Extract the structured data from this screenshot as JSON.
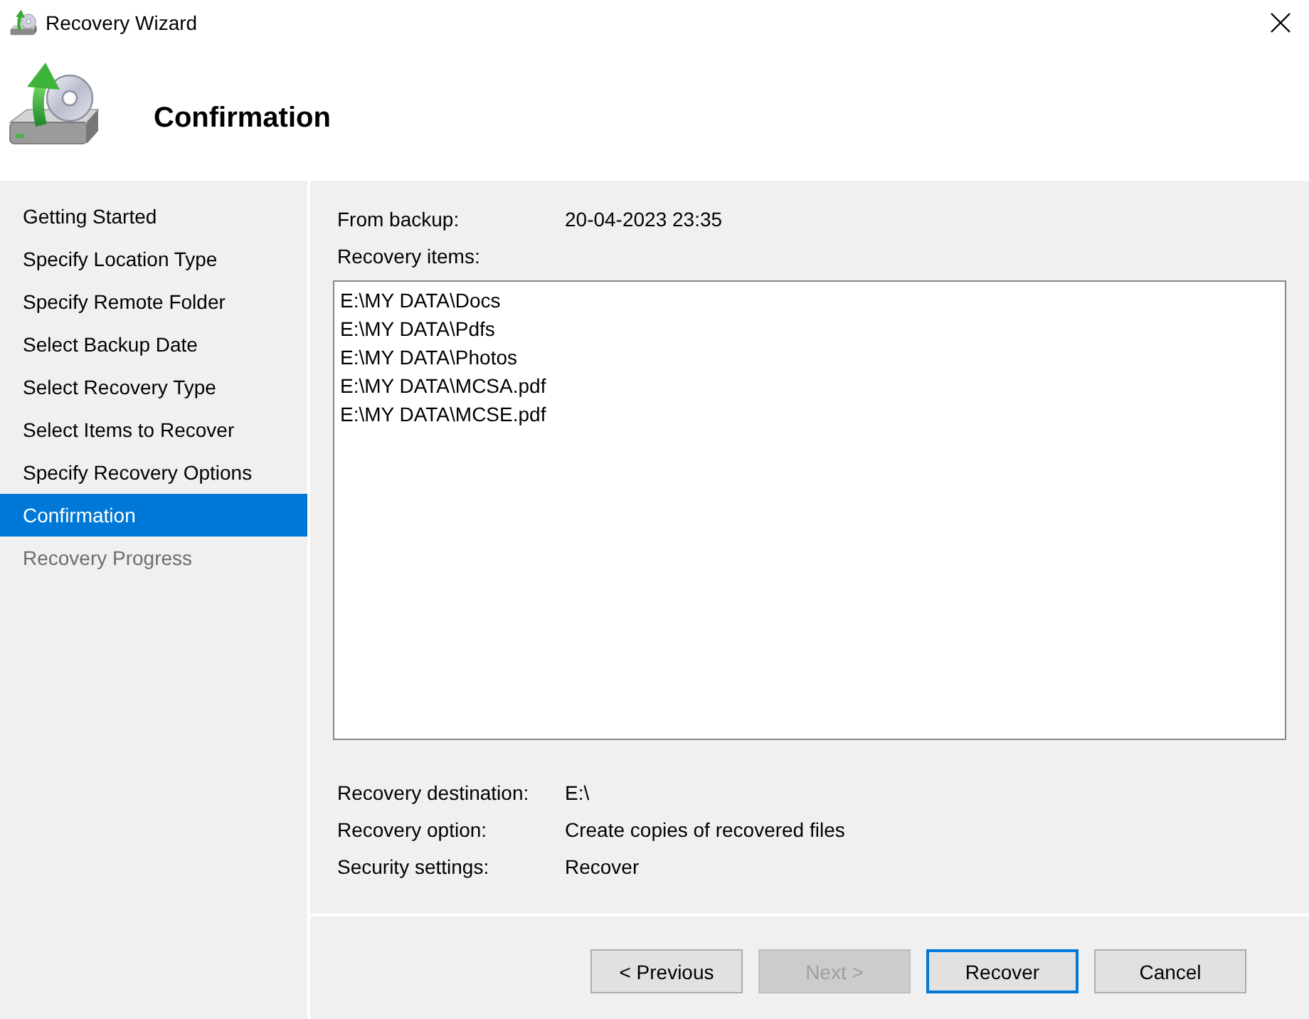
{
  "window": {
    "title": "Recovery Wizard"
  },
  "header": {
    "title": "Confirmation"
  },
  "steps": [
    {
      "label": "Getting Started",
      "selected": false,
      "disabled": false
    },
    {
      "label": "Specify Location Type",
      "selected": false,
      "disabled": false
    },
    {
      "label": "Specify Remote Folder",
      "selected": false,
      "disabled": false
    },
    {
      "label": "Select Backup Date",
      "selected": false,
      "disabled": false
    },
    {
      "label": "Select Recovery Type",
      "selected": false,
      "disabled": false
    },
    {
      "label": "Select Items to Recover",
      "selected": false,
      "disabled": false
    },
    {
      "label": "Specify Recovery Options",
      "selected": false,
      "disabled": false
    },
    {
      "label": "Confirmation",
      "selected": true,
      "disabled": false
    },
    {
      "label": "Recovery Progress",
      "selected": false,
      "disabled": true
    }
  ],
  "summary": [
    {
      "label": "From backup:",
      "value": "20-04-2023 23:35"
    }
  ],
  "recovery_items": {
    "label": "Recovery items:",
    "items": [
      "E:\\MY DATA\\Docs",
      "E:\\MY DATA\\Pdfs",
      "E:\\MY DATA\\Photos",
      "E:\\MY DATA\\MCSA.pdf",
      "E:\\MY DATA\\MCSE.pdf"
    ]
  },
  "details": [
    {
      "label": "Recovery destination:",
      "value": "E:\\"
    },
    {
      "label": "Recovery option:",
      "value": "Create copies of recovered files"
    },
    {
      "label": "Security settings:",
      "value": "Recover"
    }
  ],
  "buttons": [
    {
      "label": "< Previous",
      "disabled": false,
      "focused": false
    },
    {
      "label": "Next >",
      "disabled": true,
      "focused": false
    },
    {
      "label": "Recover",
      "disabled": false,
      "focused": true
    },
    {
      "label": "Cancel",
      "disabled": false,
      "focused": false
    }
  ]
}
